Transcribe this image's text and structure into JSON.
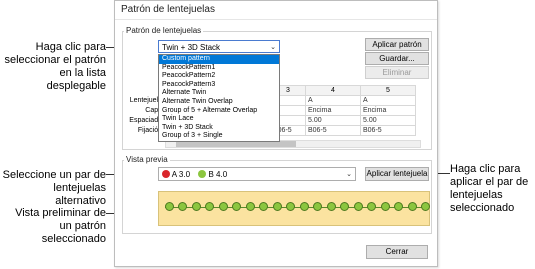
{
  "callouts": {
    "select_pattern": "Haga clic para seleccionar el patrón en la lista desplegable",
    "select_pair": "Seleccione un par de lentejuelas alternativo",
    "preview": "Vista preliminar de un patrón seleccionado",
    "apply": "Haga clic para aplicar el par de lentejuelas seleccionado"
  },
  "dialog": {
    "title": "Patrón de lentejuelas",
    "group_pattern": "Patrón de lentejuelas",
    "group_preview": "Vista previa",
    "combo_value": "Twin + 3D Stack",
    "buttons": {
      "apply_pattern": "Aplicar patrón",
      "save": "Guardar...",
      "delete": "Eliminar",
      "apply_sequin": "Aplicar lentejuela",
      "close": "Cerrar"
    },
    "dropdown_items": [
      "Custom pattern",
      "PeacockPattern1",
      "PeacockPattern2",
      "PeacockPattern3",
      "Alternate Twin",
      "Alternate Twin Overlap",
      "Group of 5 + Alternate Overlap",
      "Twin Lace",
      "Twin + 3D Stack",
      "Group of 3 + Single"
    ],
    "dropdown_selected_index": 0,
    "row_labels": [
      "Lentejuela",
      "Capa",
      "Espaciado",
      "Fijación"
    ],
    "grid": {
      "headers": [
        "3",
        "4",
        "5"
      ],
      "rows": [
        [
          "A",
          "A",
          "A"
        ],
        [
          "",
          "Encima",
          "Encima"
        ],
        [
          "",
          "5.00",
          "5.00"
        ],
        [
          "B06-5",
          "B06-5",
          "B06-5"
        ]
      ]
    },
    "sequin_pair": {
      "a_label": "A 3.0",
      "b_label": "B 4.0",
      "a_color": "#d9262b",
      "b_color": "#8cc63f"
    },
    "preview_bead_count": 20,
    "preview_colors": {
      "background": "#fbe3a0",
      "bead": "#8cc63f"
    }
  }
}
